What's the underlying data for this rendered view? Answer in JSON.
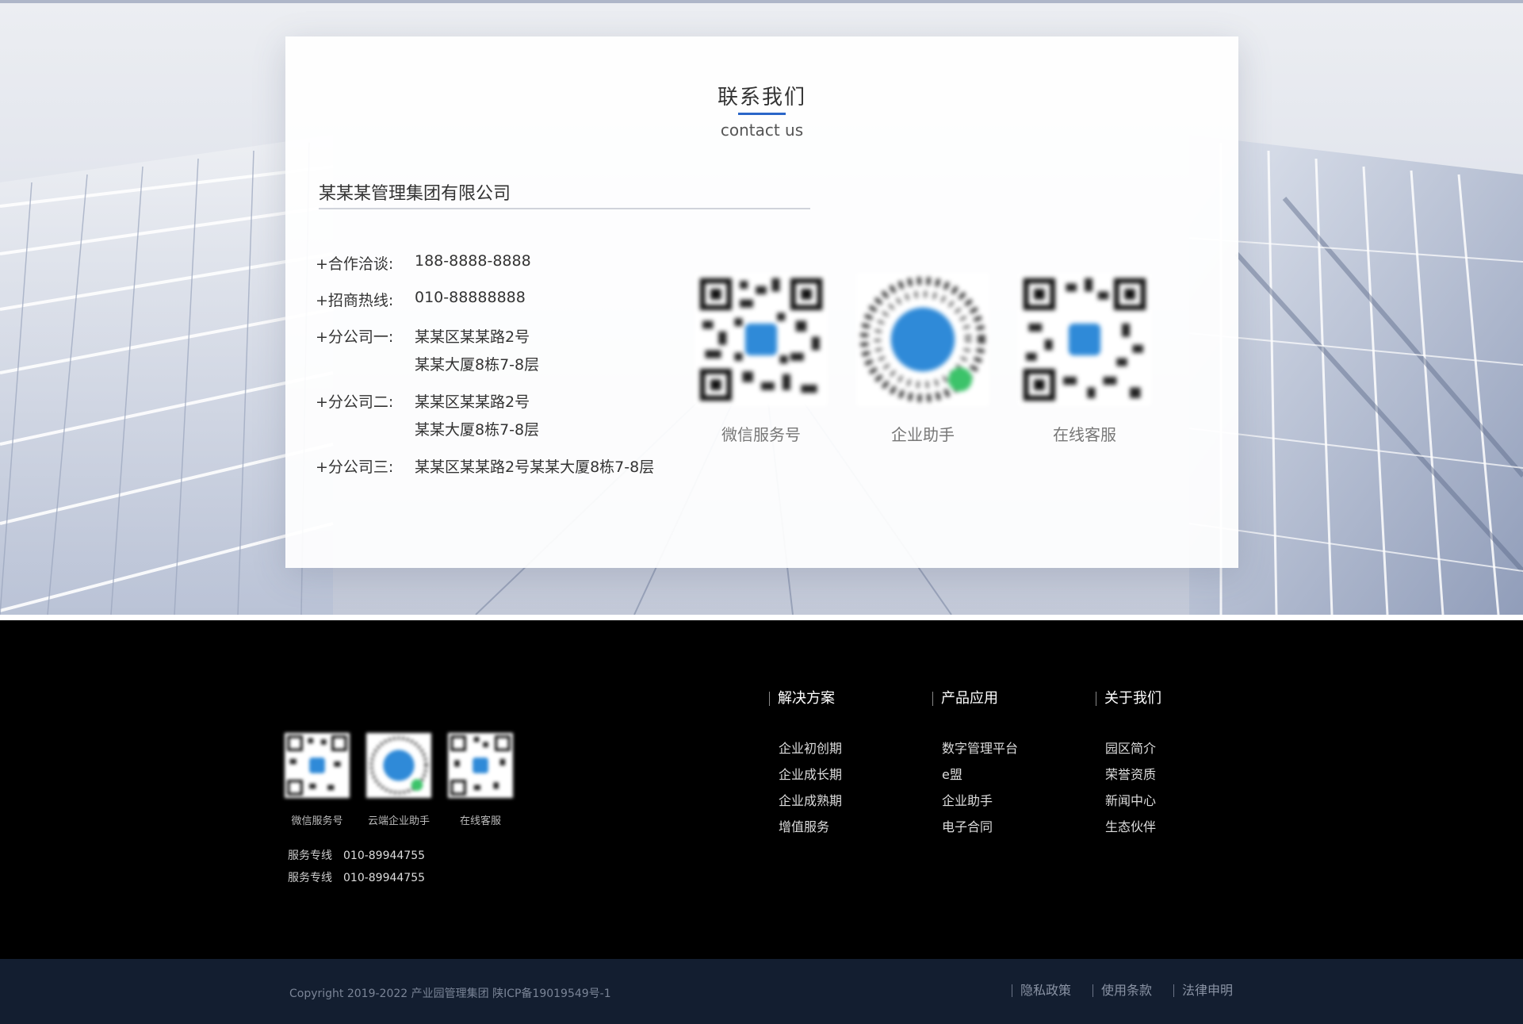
{
  "contact": {
    "title": "联系我们",
    "subtitle": "contact us",
    "company": "某某某管理集团有限公司",
    "rows": [
      {
        "label": "+合作洽谈:",
        "value": "188-8888-8888"
      },
      {
        "label": "+招商热线:",
        "value": "010-88888888"
      },
      {
        "label": "+分公司一:",
        "value": "某某区某某路2号",
        "value2": "某某大厦8栋7-8层"
      },
      {
        "label": "+分公司二:",
        "value": "某某区某某路2号",
        "value2": "某某大厦8栋7-8层"
      },
      {
        "label": "+分公司三:",
        "value": "某某区某某路2号某某大厦8栋7-8层"
      }
    ],
    "qrcodes": [
      {
        "caption": "微信服务号",
        "icon": "qr-code-icon"
      },
      {
        "caption": "企业助手",
        "icon": "mini-program-code-icon"
      },
      {
        "caption": "在线客服",
        "icon": "qr-code-icon"
      }
    ]
  },
  "footer": {
    "qrcodes": [
      {
        "caption": "微信服务号"
      },
      {
        "caption": "云端企业助手"
      },
      {
        "caption": "在线客服"
      }
    ],
    "hotlines": [
      {
        "label": "服务专线",
        "value": "010-89944755"
      },
      {
        "label": "服务专线",
        "value": "010-89944755"
      }
    ],
    "columns": [
      {
        "title": "解决方案",
        "items": [
          "企业初创期",
          "企业成长期",
          "企业成熟期",
          "增值服务"
        ]
      },
      {
        "title": "产品应用",
        "items": [
          "数字管理平台",
          "e盟",
          "企业助手",
          "电子合同"
        ]
      },
      {
        "title": "关于我们",
        "items": [
          "园区简介",
          "荣誉资质",
          "新闻中心",
          "生态伙伴"
        ]
      }
    ],
    "copyright": "Copyright 2019-2022 产业园管理集团 陕ICP备19019549号-1",
    "links": [
      "隐私政策",
      "使用条款",
      "法律申明"
    ]
  },
  "colors": {
    "accent": "#2b66c8",
    "footer_bg": "#000000",
    "bottom_bar_bg": "#131e30"
  }
}
